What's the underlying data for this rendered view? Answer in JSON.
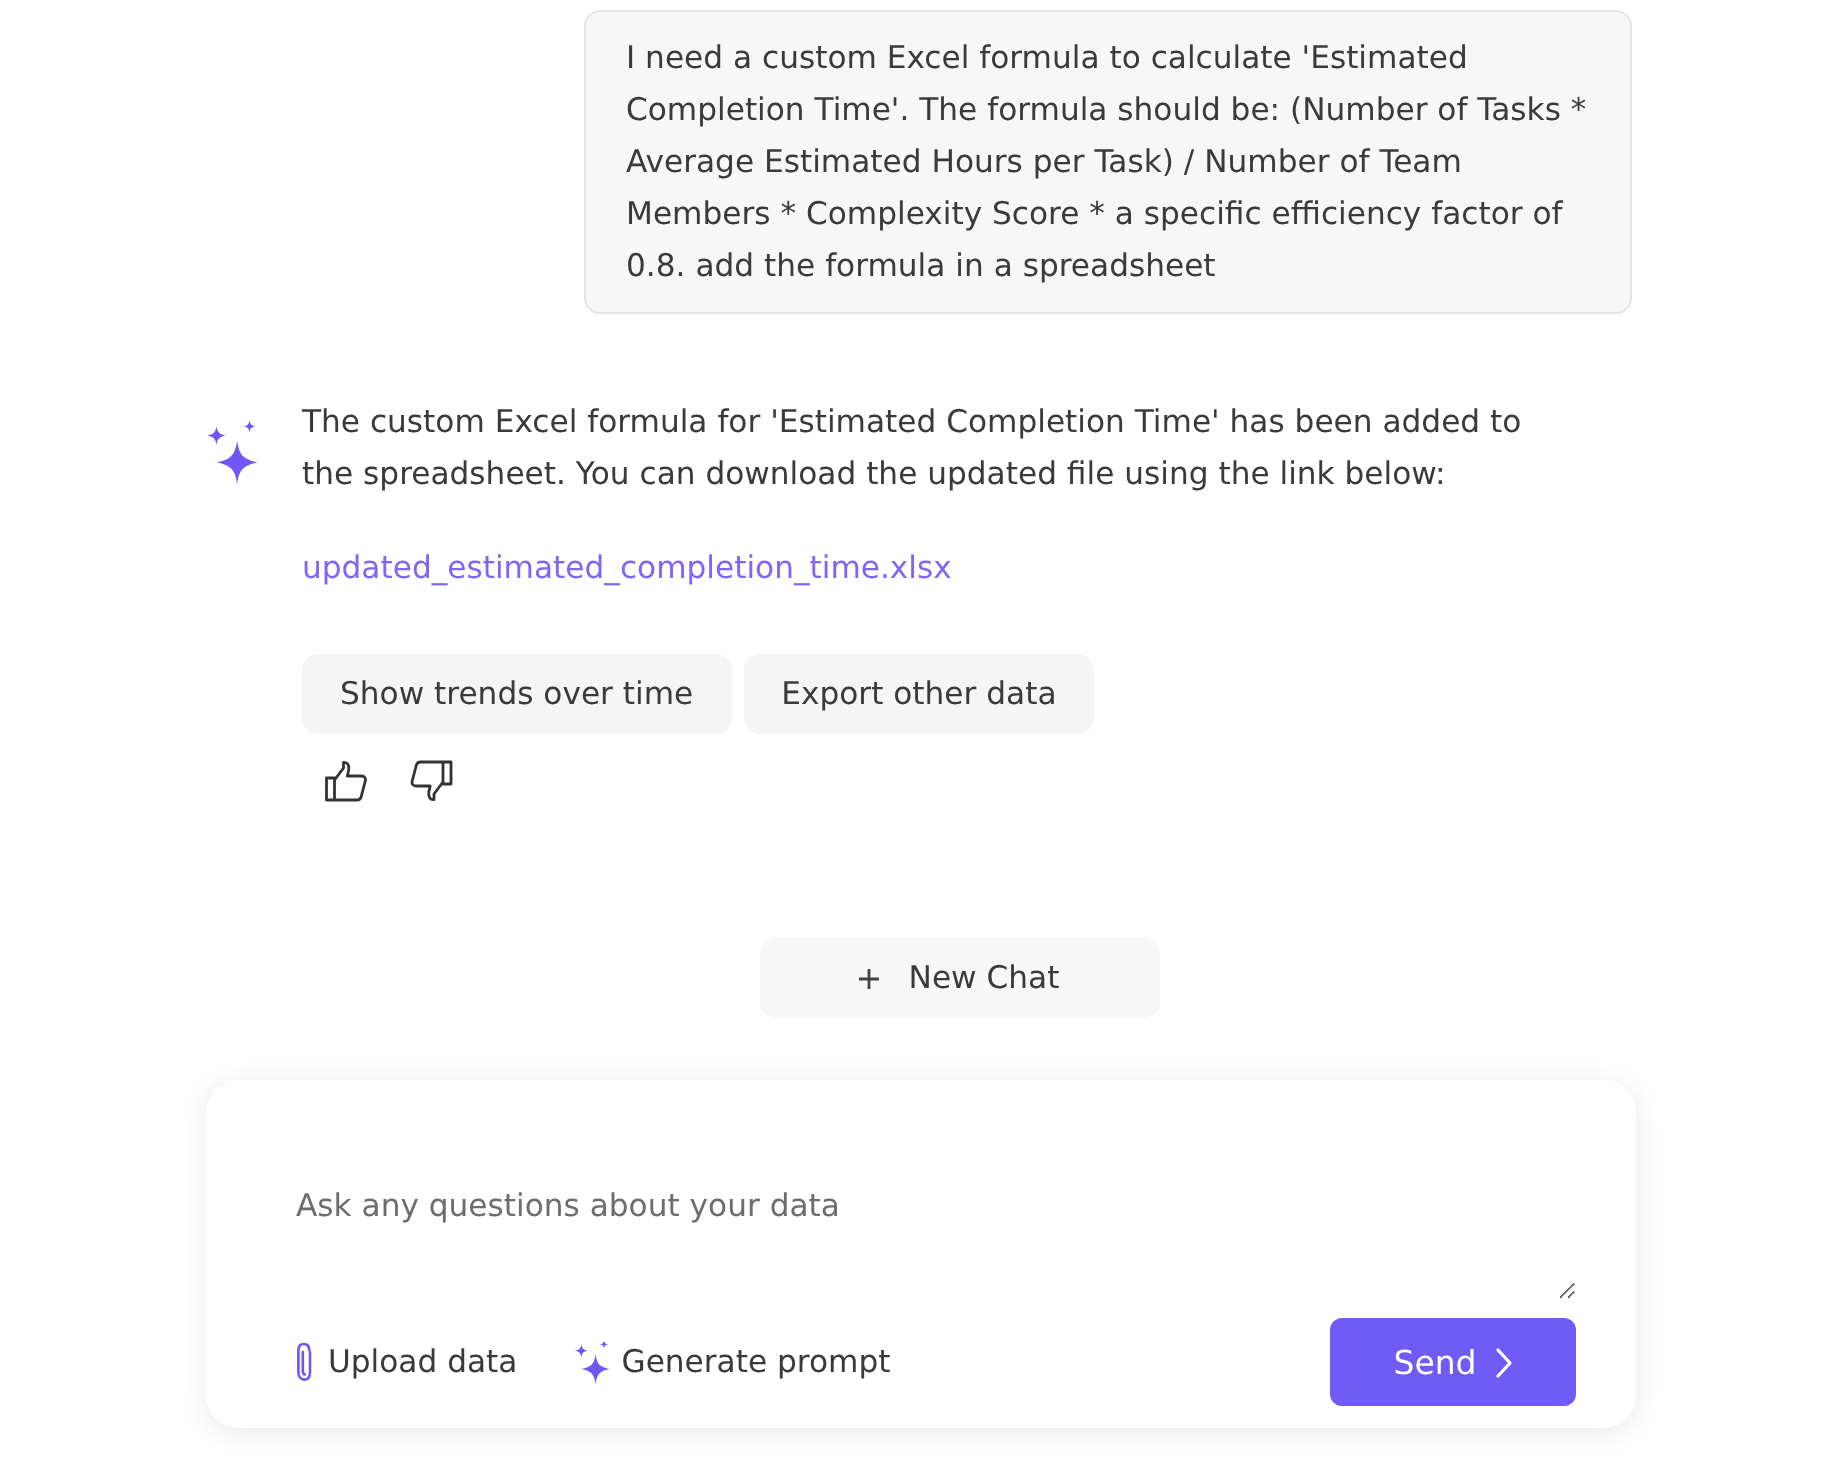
{
  "user_message": {
    "text": "I need a custom Excel formula to calculate 'Estimated Completion Time'. The formula should be: (Number of Tasks * Average Estimated Hours per Task) / Number of Team Members * Complexity Score * a specific efficiency factor of 0.8. add the formula in a spreadsheet"
  },
  "assistant_message": {
    "text": "The custom Excel formula for 'Estimated Completion Time' has been added to the spreadsheet. You can download the updated file using the link below:",
    "file_link": "updated_estimated_completion_time.xlsx",
    "suggestions": [
      "Show trends over time",
      "Export other data"
    ]
  },
  "new_chat_button": {
    "label": "New Chat"
  },
  "composer": {
    "placeholder": "Ask any questions about your data",
    "actions": [
      {
        "kind": "upload",
        "label": "Upload data"
      },
      {
        "kind": "generate",
        "label": "Generate prompt"
      }
    ],
    "send_button": {
      "label": "Send"
    }
  }
}
